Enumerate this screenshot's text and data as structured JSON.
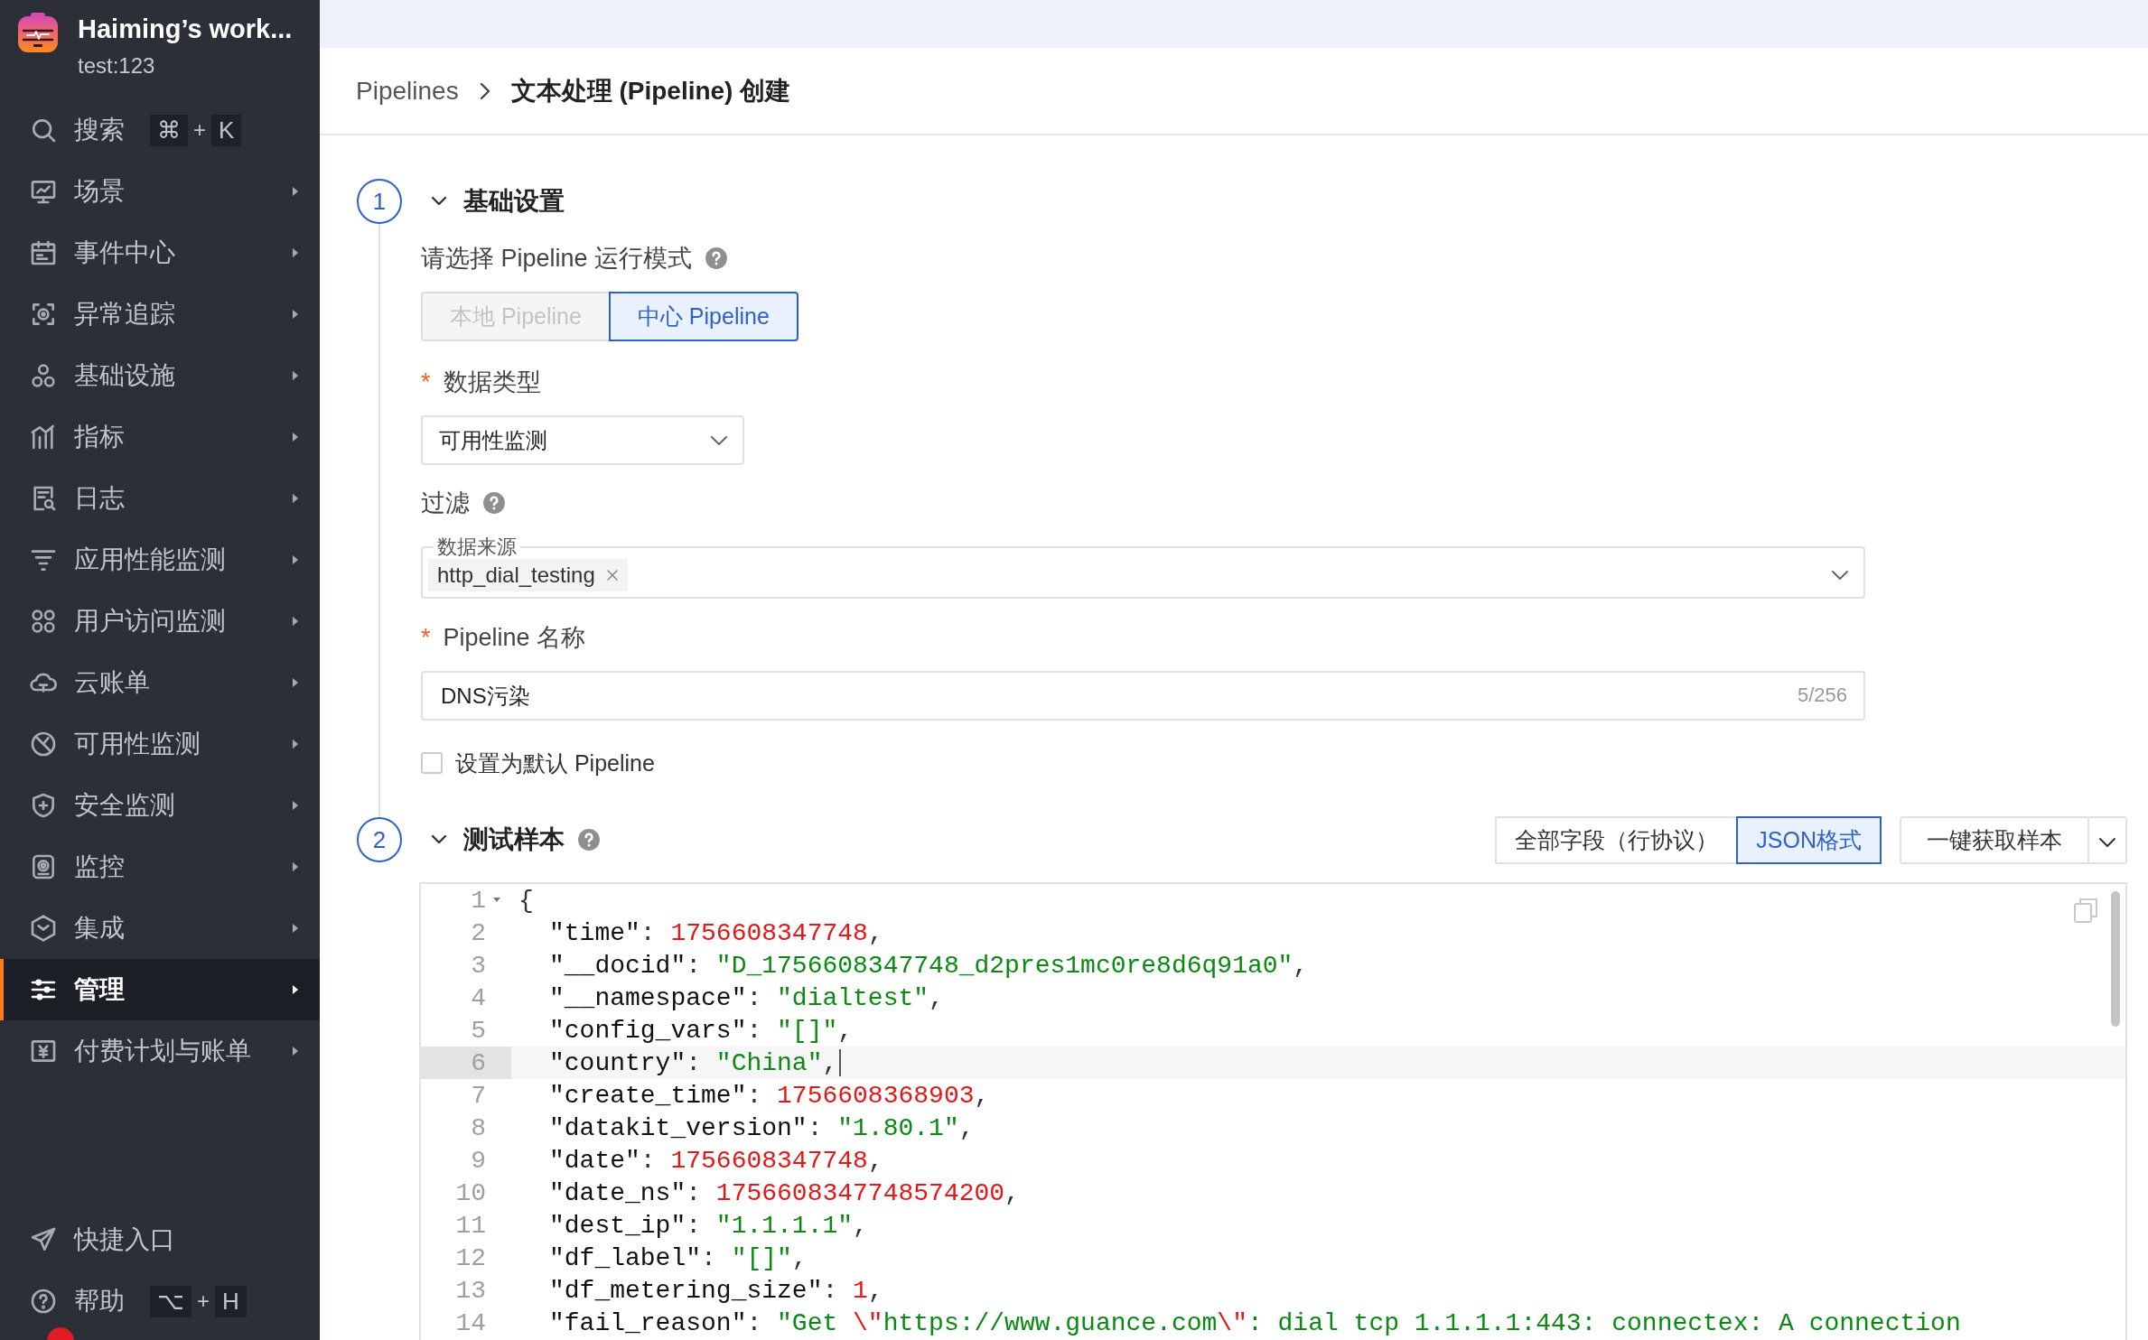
{
  "workspace": {
    "name": "Haiming’s work...",
    "subtitle": "test:123"
  },
  "sidebar": {
    "search": {
      "label": "搜索",
      "keys": [
        "⌘",
        "K"
      ],
      "joiner": "+"
    },
    "items": [
      {
        "label": "场景",
        "selected": false
      },
      {
        "label": "事件中心",
        "selected": false
      },
      {
        "label": "异常追踪",
        "selected": false
      },
      {
        "label": "基础设施",
        "selected": false
      },
      {
        "label": "指标",
        "selected": false
      },
      {
        "label": "日志",
        "selected": false
      },
      {
        "label": "应用性能监测",
        "selected": false
      },
      {
        "label": "用户访问监测",
        "selected": false
      },
      {
        "label": "云账单",
        "selected": false
      },
      {
        "label": "可用性监测",
        "selected": false
      },
      {
        "label": "安全监测",
        "selected": false
      },
      {
        "label": "监控",
        "selected": false
      },
      {
        "label": "集成",
        "selected": false
      },
      {
        "label": "管理",
        "selected": true
      },
      {
        "label": "付费计划与账单",
        "selected": false
      }
    ],
    "bottom": [
      {
        "label": "快捷入口"
      },
      {
        "label": "帮助",
        "keys": [
          "⌥",
          "H"
        ],
        "joiner": "+"
      }
    ]
  },
  "breadcrumb": [
    "Pipelines",
    "文本处理 (Pipeline) 创建"
  ],
  "sections": [
    {
      "number": "1",
      "title": "基础设置",
      "expanded": true
    },
    {
      "number": "2",
      "title": "测试样本",
      "expanded": true
    }
  ],
  "basic": {
    "run_mode": {
      "label": "请选择 Pipeline 运行模式",
      "options": [
        {
          "label": "本地 Pipeline",
          "selected": false,
          "disabled": true
        },
        {
          "label": "中心 Pipeline",
          "selected": true,
          "disabled": false
        }
      ]
    },
    "data_type": {
      "required_mark": "*",
      "label": "数据类型",
      "value": "可用性监测"
    },
    "filter": {
      "label": "过滤",
      "legend": "数据来源",
      "tags": [
        "http_dial_testing"
      ]
    },
    "name": {
      "required_mark": "*",
      "label": "Pipeline 名称",
      "value": "DNS污染",
      "counter": "5/256"
    },
    "default": {
      "label": "设置为默认 Pipeline",
      "checked": false
    }
  },
  "sample": {
    "formats": [
      {
        "label": "全部字段（行协议）",
        "selected": false
      },
      {
        "label": "JSON格式",
        "selected": true
      }
    ],
    "fetch_button": "一键获取样本",
    "lines": [
      {
        "number": "1",
        "kind": "open",
        "active": false,
        "tokens": [
          {
            "kind": "punct",
            "text": "{"
          }
        ]
      },
      {
        "number": "2",
        "kind": "member",
        "active": false,
        "tokens": [
          {
            "kind": "key",
            "text": "\"time\""
          },
          {
            "kind": "punct",
            "text": ": "
          },
          {
            "kind": "number",
            "text": "1756608347748"
          },
          {
            "kind": "punct",
            "text": ","
          }
        ]
      },
      {
        "number": "3",
        "kind": "member",
        "active": false,
        "tokens": [
          {
            "kind": "key",
            "text": "\"__docid\""
          },
          {
            "kind": "punct",
            "text": ": "
          },
          {
            "kind": "string",
            "text": "\"D_1756608347748_d2pres1mc0re8d6q91a0\""
          },
          {
            "kind": "punct",
            "text": ","
          }
        ]
      },
      {
        "number": "4",
        "kind": "member",
        "active": false,
        "tokens": [
          {
            "kind": "key",
            "text": "\"__namespace\""
          },
          {
            "kind": "punct",
            "text": ": "
          },
          {
            "kind": "string",
            "text": "\"dialtest\""
          },
          {
            "kind": "punct",
            "text": ","
          }
        ]
      },
      {
        "number": "5",
        "kind": "member",
        "active": false,
        "tokens": [
          {
            "kind": "key",
            "text": "\"config_vars\""
          },
          {
            "kind": "punct",
            "text": ": "
          },
          {
            "kind": "string",
            "text": "\"[]\""
          },
          {
            "kind": "punct",
            "text": ","
          }
        ]
      },
      {
        "number": "6",
        "kind": "member",
        "active": true,
        "tokens": [
          {
            "kind": "key",
            "text": "\"country\""
          },
          {
            "kind": "punct",
            "text": ": "
          },
          {
            "kind": "string",
            "text": "\"China\""
          },
          {
            "kind": "punct",
            "text": ","
          }
        ]
      },
      {
        "number": "7",
        "kind": "member",
        "active": false,
        "tokens": [
          {
            "kind": "key",
            "text": "\"create_time\""
          },
          {
            "kind": "punct",
            "text": ": "
          },
          {
            "kind": "number",
            "text": "1756608368903"
          },
          {
            "kind": "punct",
            "text": ","
          }
        ]
      },
      {
        "number": "8",
        "kind": "member",
        "active": false,
        "tokens": [
          {
            "kind": "key",
            "text": "\"datakit_version\""
          },
          {
            "kind": "punct",
            "text": ": "
          },
          {
            "kind": "string",
            "text": "\"1.80.1\""
          },
          {
            "kind": "punct",
            "text": ","
          }
        ]
      },
      {
        "number": "9",
        "kind": "member",
        "active": false,
        "tokens": [
          {
            "kind": "key",
            "text": "\"date\""
          },
          {
            "kind": "punct",
            "text": ": "
          },
          {
            "kind": "number",
            "text": "1756608347748"
          },
          {
            "kind": "punct",
            "text": ","
          }
        ]
      },
      {
        "number": "10",
        "kind": "member",
        "active": false,
        "tokens": [
          {
            "kind": "key",
            "text": "\"date_ns\""
          },
          {
            "kind": "punct",
            "text": ": "
          },
          {
            "kind": "number",
            "text": "1756608347748574200"
          },
          {
            "kind": "punct",
            "text": ","
          }
        ]
      },
      {
        "number": "11",
        "kind": "member",
        "active": false,
        "tokens": [
          {
            "kind": "key",
            "text": "\"dest_ip\""
          },
          {
            "kind": "punct",
            "text": ": "
          },
          {
            "kind": "string",
            "text": "\"1.1.1.1\""
          },
          {
            "kind": "punct",
            "text": ","
          }
        ]
      },
      {
        "number": "12",
        "kind": "member",
        "active": false,
        "tokens": [
          {
            "kind": "key",
            "text": "\"df_label\""
          },
          {
            "kind": "punct",
            "text": ": "
          },
          {
            "kind": "string",
            "text": "\"[]\""
          },
          {
            "kind": "punct",
            "text": ","
          }
        ]
      },
      {
        "number": "13",
        "kind": "member",
        "active": false,
        "tokens": [
          {
            "kind": "key",
            "text": "\"df_metering_size\""
          },
          {
            "kind": "punct",
            "text": ": "
          },
          {
            "kind": "number",
            "text": "1"
          },
          {
            "kind": "punct",
            "text": ","
          }
        ]
      },
      {
        "number": "14",
        "kind": "member",
        "active": false,
        "tokens": [
          {
            "kind": "key",
            "text": "\"fail_reason\""
          },
          {
            "kind": "punct",
            "text": ": "
          },
          {
            "kind": "string",
            "text": "\"Get "
          },
          {
            "kind": "escape",
            "text": "\\\""
          },
          {
            "kind": "string",
            "text": "https://www.guance.com"
          },
          {
            "kind": "escape",
            "text": "\\\""
          },
          {
            "kind": "string",
            "text": ": dial tcp 1.1.1.1:443: connectex: A connection"
          }
        ]
      }
    ]
  }
}
